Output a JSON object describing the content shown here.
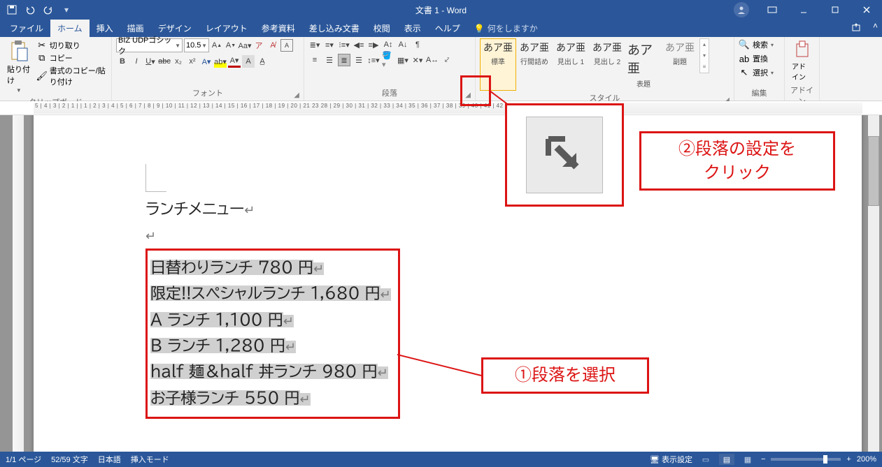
{
  "title": "文書 1 - Word",
  "qat": {
    "save": "save-icon",
    "undo": "undo-icon",
    "redo": "redo-icon"
  },
  "tabs": {
    "file": "ファイル",
    "home": "ホーム",
    "insert": "挿入",
    "draw": "描画",
    "design": "デザイン",
    "layout": "レイアウト",
    "references": "参考資料",
    "mailings": "差し込み文書",
    "review": "校閲",
    "view": "表示",
    "help": "ヘルプ",
    "tellme": "何をしますか"
  },
  "ribbon": {
    "clipboard": {
      "label": "クリップボード",
      "paste": "貼り付け",
      "cut": "切り取り",
      "copy": "コピー",
      "format_painter": "書式のコピー/貼り付け"
    },
    "font": {
      "label": "フォント",
      "name": "BIZ UDPゴシック",
      "size": "10.5"
    },
    "paragraph": {
      "label": "段落"
    },
    "styles": {
      "label": "スタイル",
      "items": [
        {
          "sample": "あア亜",
          "name": "標準"
        },
        {
          "sample": "あア亜",
          "name": "行間詰め"
        },
        {
          "sample": "あア亜",
          "name": "見出し 1"
        },
        {
          "sample": "あア亜",
          "name": "見出し 2"
        },
        {
          "sample": "あア亜",
          "name": "表題"
        },
        {
          "sample": "あア亜",
          "name": "副題"
        }
      ]
    },
    "editing": {
      "label": "編集",
      "find": "検索",
      "replace": "置換",
      "select": "選択"
    },
    "addins": {
      "label": "アドイン",
      "button": "アドイン"
    }
  },
  "ruler": "5 | 4 | 3 | 2 | 1 |  | 1 | 2 | 3 | 4 | 5 | 6 | 7 | 8 | 9 | 10 | 11 | 12 | 13 | 14 | 15 | 16 | 17 | 18 | 19 | 20 | 21    23            28 | 29 | 30 | 31 | 32 | 33 | 34 | 35 | 36 | 37 | 38 | 39 | 40 | 41 | 42 | 43",
  "document": {
    "title_line": "ランチメニュー",
    "lines": [
      "日替わりランチ 780 円",
      "限定!!スペシャルランチ 1,680 円",
      "A ランチ 1,100 円",
      "B ランチ 1,280 円",
      "half 麺＆half 丼ランチ 980 円",
      "お子様ランチ 550 円"
    ]
  },
  "annotations": {
    "step1": "①段落を選択",
    "step2_line1": "②段落の設定を",
    "step2_line2": "クリック"
  },
  "status": {
    "page": "1/1 ページ",
    "words": "52/59 文字",
    "lang": "日本語",
    "mode": "挿入モード",
    "display": "表示設定",
    "zoom": "200%"
  }
}
